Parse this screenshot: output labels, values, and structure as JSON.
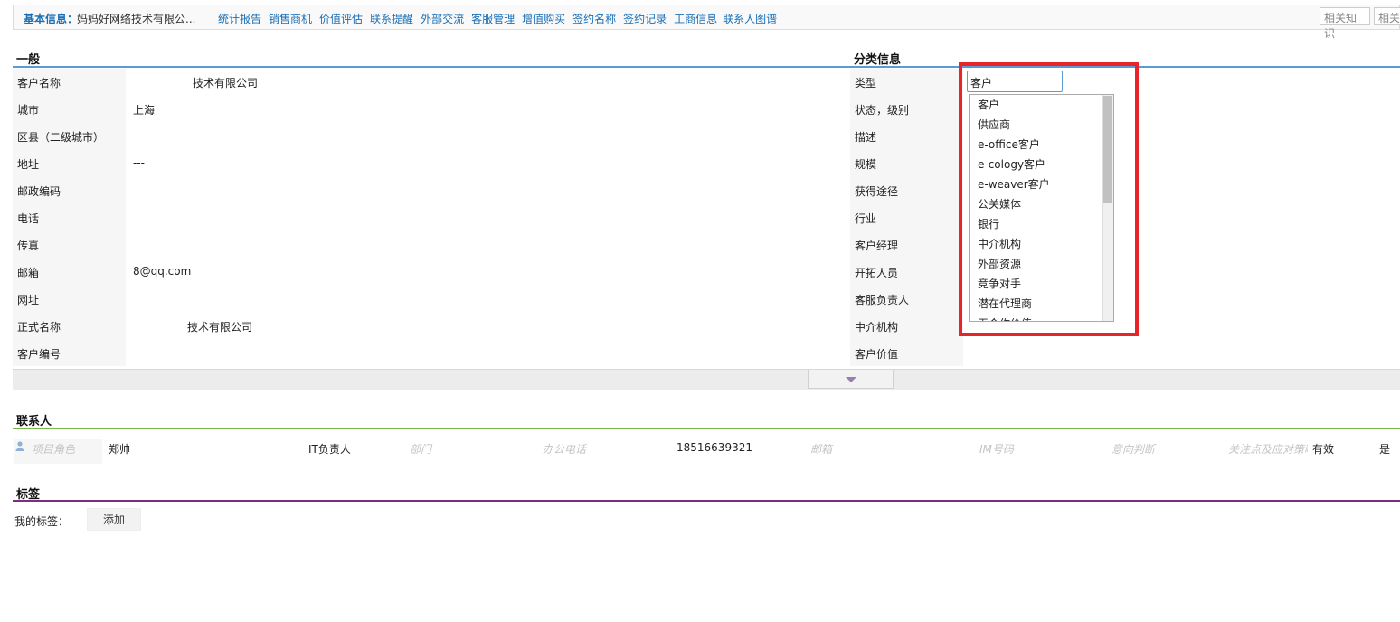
{
  "topbar": {
    "base_label": "基本信息：",
    "base_name": "妈妈好网络技术有限公...",
    "tabs": [
      "统计报告",
      "销售商机",
      "价值评估",
      "联系提醒",
      "外部交流",
      "客服管理",
      "增值购买",
      "签约名称",
      "签约记录",
      "工商信息",
      "联系人图谱"
    ],
    "right_buttons": [
      "相关知识",
      "相关"
    ]
  },
  "general": {
    "title": "一般",
    "rows": [
      {
        "label": "客户名称",
        "value": "技术有限公司"
      },
      {
        "label": "城市",
        "value": "上海"
      },
      {
        "label": "区县（二级城市）",
        "value": ""
      },
      {
        "label": "地址",
        "value": "---"
      },
      {
        "label": "邮政编码",
        "value": ""
      },
      {
        "label": "电话",
        "value": ""
      },
      {
        "label": "传真",
        "value": ""
      },
      {
        "label": "邮箱",
        "value": "8@qq.com"
      },
      {
        "label": "网址",
        "value": ""
      },
      {
        "label": "正式名称",
        "value": "技术有限公司"
      },
      {
        "label": "客户编号",
        "value": ""
      }
    ]
  },
  "category": {
    "title": "分类信息",
    "rows": [
      {
        "label": "类型"
      },
      {
        "label": "状态，级别"
      },
      {
        "label": "描述"
      },
      {
        "label": "规模"
      },
      {
        "label": "获得途径"
      },
      {
        "label": "行业"
      },
      {
        "label": "客户经理"
      },
      {
        "label": "开拓人员"
      },
      {
        "label": "客服负责人"
      },
      {
        "label": "中介机构"
      },
      {
        "label": "客户价值"
      }
    ],
    "type_select": {
      "value": "客户",
      "options": [
        "客户",
        "供应商",
        "e-office客户",
        "e-cology客户",
        "e-weaver客户",
        "公关媒体",
        "银行",
        "中介机构",
        "外部资源",
        "竞争对手",
        "潜在代理商",
        "无合作价值"
      ]
    }
  },
  "contacts": {
    "title": "联系人",
    "row": {
      "role_placeholder": "项目角色",
      "name": "郑帅",
      "position": "IT负责人",
      "dept_placeholder": "部门",
      "office_phone_placeholder": "办公电话",
      "mobile": "18516639321",
      "email_placeholder": "邮箱",
      "im_placeholder": "IM号码",
      "intent_placeholder": "意向判断",
      "focus_placeholder": "关注点及应对策略",
      "status": "有效",
      "flag": "是"
    }
  },
  "tags": {
    "title": "标签",
    "my_tags_label": "我的标签：",
    "add_label": "添加"
  },
  "colors": {
    "link": "#1a6fb5",
    "general_line": "#5b9bd5",
    "contacts_line": "#7ab648",
    "tags_line": "#7b2d82",
    "highlight": "#e8232a"
  }
}
